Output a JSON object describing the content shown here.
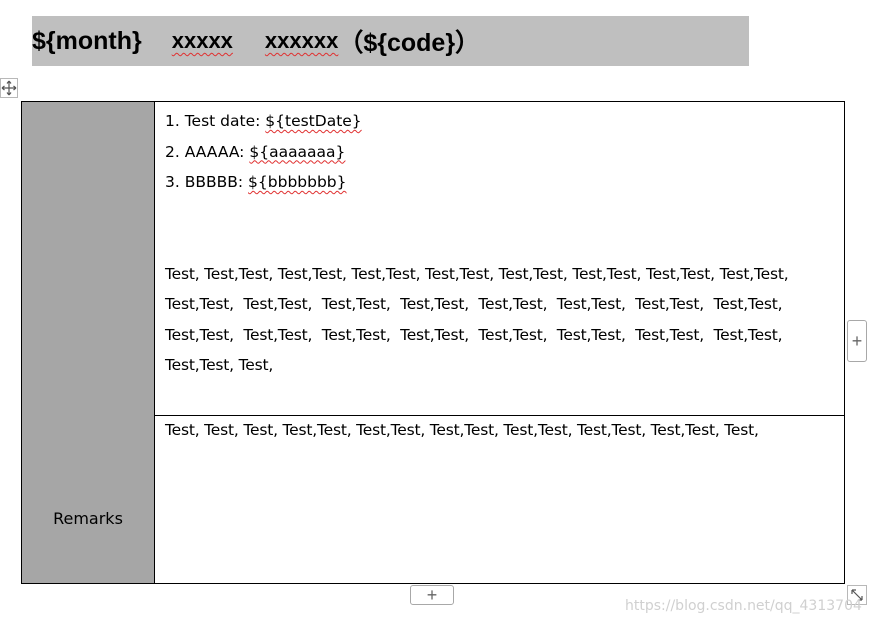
{
  "title": {
    "month": "${month}",
    "x1": "xxxxx",
    "x2": "xxxxxx",
    "code": "（${code}）"
  },
  "table": {
    "row1": {
      "items": [
        {
          "prefix": "1. Test date: ",
          "placeholder": "${testDate}",
          "squiggle": "testDate"
        },
        {
          "prefix": "2. AAAAA: ",
          "placeholder": "${aaaaaaa}",
          "squiggle": "aaaaaaa"
        },
        {
          "prefix": "3. BBBBB: ",
          "placeholder": "${bbbbbbb}",
          "squiggle": "bbbbbbb"
        }
      ],
      "test_lines": [
        "Test, Test,Test, Test,Test, Test,Test, Test,Test, Test,Test, Test,Test, Test,Test, Test,Test,",
        "Test,Test,  Test,Test,  Test,Test,  Test,Test,  Test,Test,  Test,Test,  Test,Test,  Test,Test,",
        "Test,Test,  Test,Test,  Test,Test,  Test,Test,  Test,Test,  Test,Test,  Test,Test,  Test,Test,",
        "Test,Test, Test,"
      ]
    },
    "row2": {
      "label": "Remarks",
      "text": "Test, Test, Test, Test,Test, Test,Test, Test,Test, Test,Test, Test,Test, Test,Test, Test,"
    }
  },
  "controls": {
    "add_column_glyph": "+",
    "add_row_glyph": "+"
  },
  "watermark": "https://blog.csdn.net/qq_4313704"
}
